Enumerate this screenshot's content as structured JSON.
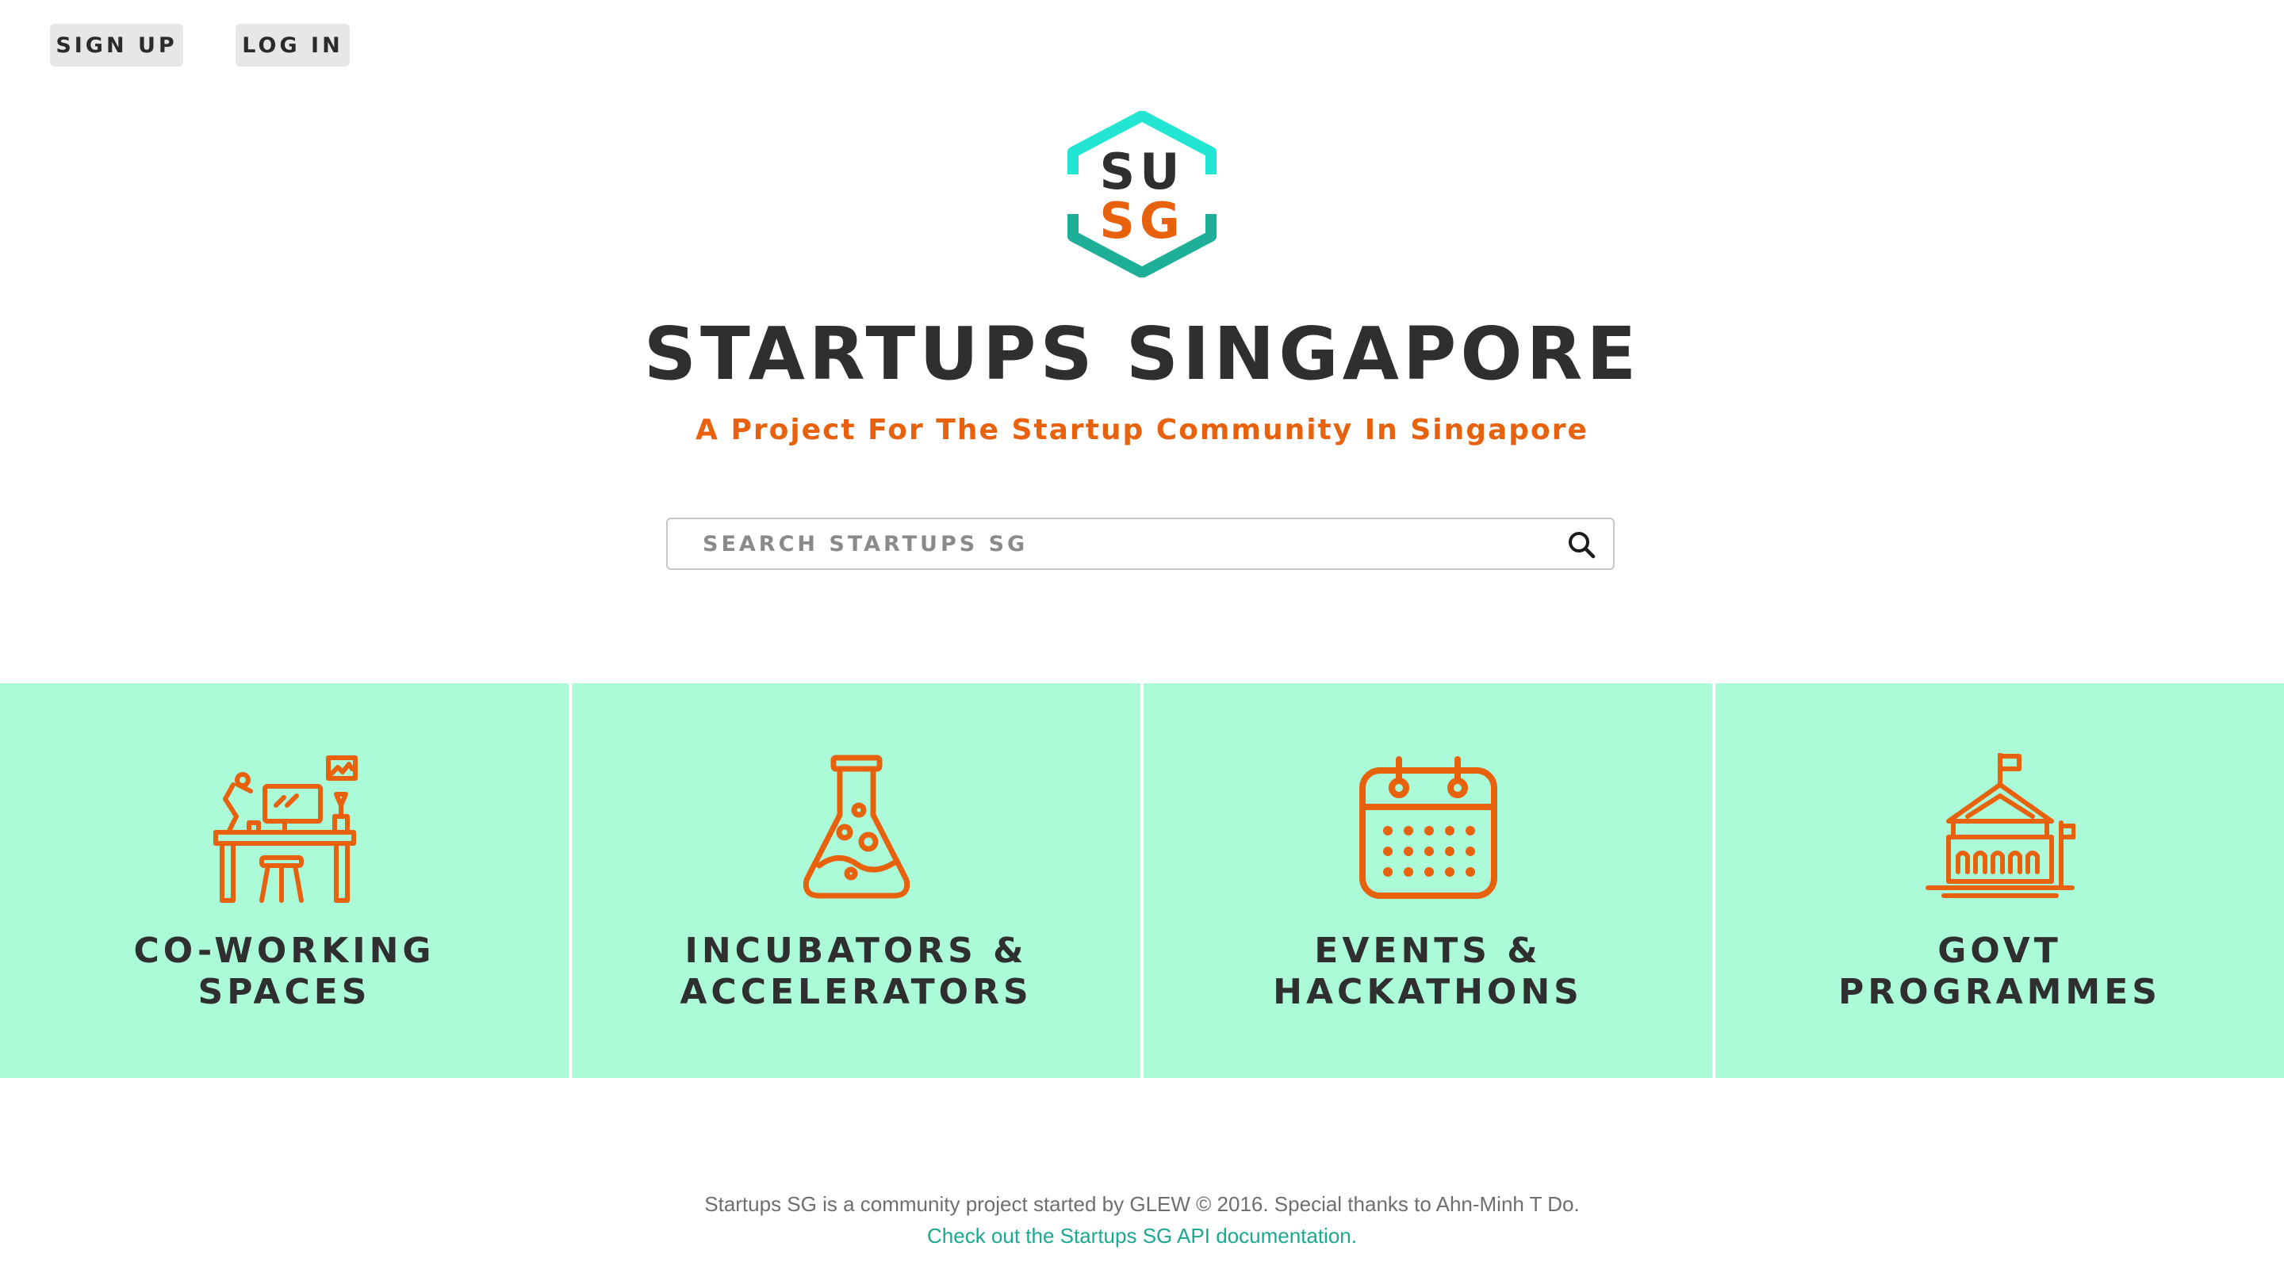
{
  "header": {
    "signup_label": "SIGN UP",
    "login_label": "LOG IN"
  },
  "logo": {
    "line1": "SU",
    "line2": "SG"
  },
  "title": "STARTUPS SINGAPORE",
  "tagline": "A Project For The Startup Community In Singapore",
  "search": {
    "placeholder": "SEARCH STARTUPS SG",
    "value": ""
  },
  "tiles": [
    {
      "line1": "CO-WORKING",
      "line2": "SPACES",
      "icon": "desk-icon"
    },
    {
      "line1": "INCUBATORS &",
      "line2": "ACCELERATORS",
      "icon": "flask-icon"
    },
    {
      "line1": "EVENTS &",
      "line2": "HACKATHONS",
      "icon": "calendar-icon"
    },
    {
      "line1": "GOVT",
      "line2": "PROGRAMMES",
      "icon": "government-building-icon"
    }
  ],
  "footer": {
    "text": "Startups SG is a community project started by GLEW © 2016. Special thanks to Ahn-Minh T Do.",
    "link": "Check out the Startups SG API documentation."
  },
  "colors": {
    "accent_orange": "#e8610d",
    "tile_bg": "#abfbd9",
    "logo_teal_top": "#22e6d2",
    "logo_teal_bottom": "#1fae98",
    "link_teal": "#1aa88f",
    "text_dark": "#2f2f2f"
  }
}
